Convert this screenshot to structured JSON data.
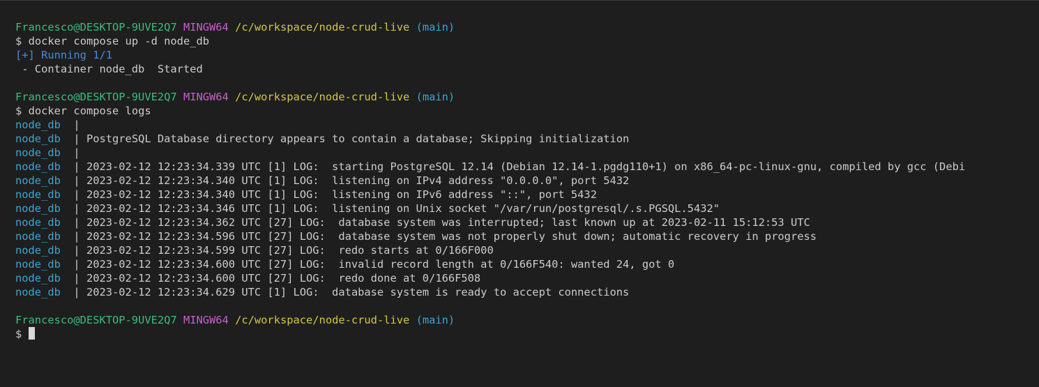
{
  "window": {
    "type": "terminal"
  },
  "prompt": {
    "user_host": "Francesco@DESKTOP-9UVE2Q7",
    "system": "MINGW64",
    "path": "/c/workspace/node-crud-live",
    "branch": "(main)",
    "symbol": "$"
  },
  "commands": {
    "up": "docker compose up -d node_db",
    "logs": "docker compose logs"
  },
  "up_output": {
    "running": "[+] Running 1/1",
    "container": " - Container node_db  Started"
  },
  "logs": {
    "service": "node_db",
    "separator": "  | ",
    "lines": [
      "",
      "PostgreSQL Database directory appears to contain a database; Skipping initialization",
      "",
      "2023-02-12 12:23:34.339 UTC [1] LOG:  starting PostgreSQL 12.14 (Debian 12.14-1.pgdg110+1) on x86_64-pc-linux-gnu, compiled by gcc (Debi",
      "2023-02-12 12:23:34.340 UTC [1] LOG:  listening on IPv4 address \"0.0.0.0\", port 5432",
      "2023-02-12 12:23:34.340 UTC [1] LOG:  listening on IPv6 address \"::\", port 5432",
      "2023-02-12 12:23:34.346 UTC [1] LOG:  listening on Unix socket \"/var/run/postgresql/.s.PGSQL.5432\"",
      "2023-02-12 12:23:34.362 UTC [27] LOG:  database system was interrupted; last known up at 2023-02-11 15:12:53 UTC",
      "2023-02-12 12:23:34.596 UTC [27] LOG:  database system was not properly shut down; automatic recovery in progress",
      "2023-02-12 12:23:34.599 UTC [27] LOG:  redo starts at 0/166F000",
      "2023-02-12 12:23:34.600 UTC [27] LOG:  invalid record length at 0/166F540: wanted 24, got 0",
      "2023-02-12 12:23:34.600 UTC [27] LOG:  redo done at 0/166F508",
      "2023-02-12 12:23:34.629 UTC [1] LOG:  database system is ready to accept connections"
    ]
  }
}
